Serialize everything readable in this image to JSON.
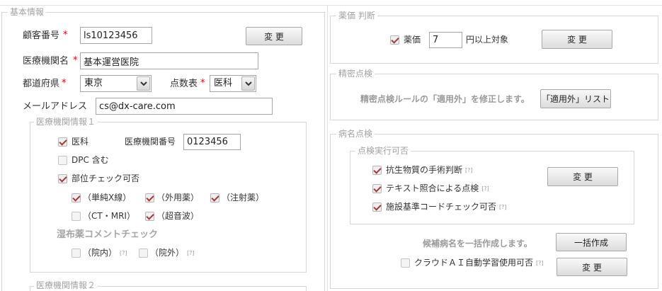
{
  "basic_info": {
    "legend": "基本情報",
    "customer_no": {
      "label": "顧客番号",
      "required": "*",
      "value": "ls10123456"
    },
    "change_button": "変 更",
    "facility_name": {
      "label": "医療機関名",
      "required": "*",
      "value": "基本運営医院"
    },
    "prefecture": {
      "label": "都道府県",
      "required": "*",
      "value": "東京"
    },
    "fee_table": {
      "label": "点数表",
      "required": "*",
      "value": "医科"
    },
    "email": {
      "label": "メールアドレス",
      "value": "cs@dx-care.com"
    },
    "facility_info_1": {
      "legend": "医療機関情報１",
      "medical": {
        "label": "医科",
        "checked": true
      },
      "facility_no": {
        "label": "医療機関番号",
        "value": "0123456"
      },
      "dpc": {
        "label": "DPC 含む",
        "checked": false
      },
      "site_check": {
        "label": "部位チェック可否",
        "checked": true
      },
      "xray": {
        "label": "（単純X線）",
        "checked": true
      },
      "external": {
        "label": "（外用薬）",
        "checked": true
      },
      "injection": {
        "label": "（注射薬）",
        "checked": true
      },
      "ct_mri": {
        "label": "（CT・MRI）",
        "checked": false
      },
      "ultrasound": {
        "label": "（超音波）",
        "checked": true
      },
      "poultice_heading": "湿布薬コメントチェック",
      "inpatient": {
        "label": "（院内）",
        "checked": false,
        "help": "[?]"
      },
      "outpatient": {
        "label": "（院外）",
        "checked": false,
        "help": "[?]"
      }
    },
    "facility_info_2": {
      "legend": "医療機関情報２"
    }
  },
  "drug_price": {
    "legend": "薬価 判断",
    "checkbox_label": "薬価",
    "checked": true,
    "value": "7",
    "suffix": "円以上対象",
    "button": "変 更"
  },
  "precision_check": {
    "legend": "精密点検",
    "description": "精密点検ルールの「適用外」を修正します。",
    "button": "「適用外」リスト"
  },
  "disease_check": {
    "legend": "病名点検",
    "execution": {
      "legend": "点検実行可否",
      "items": [
        {
          "label": "抗生物質の手術判断",
          "checked": true,
          "help": "[?]"
        },
        {
          "label": "テキスト照合による点検",
          "checked": true,
          "help": "[?]"
        },
        {
          "label": "施設基準コードチェック可否",
          "checked": true,
          "help": "[?]"
        }
      ],
      "button": "変 更"
    },
    "bulk": {
      "description": "候補病名を一括作成します。",
      "button": "一括作成"
    },
    "cloud_ai": {
      "label": "クラウドＡＩ自動学習使用可否",
      "checked": false,
      "help": "[?]",
      "button": "変 更"
    }
  },
  "colors": {
    "required": "#e00000",
    "check_mark": "#a33a3a",
    "border": "#d6d6d6"
  }
}
